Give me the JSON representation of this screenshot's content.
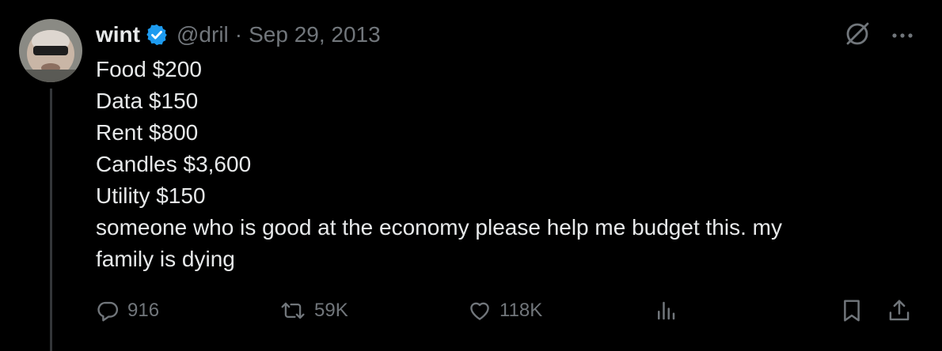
{
  "tweet": {
    "display_name": "wint",
    "handle": "@dril",
    "separator": "·",
    "date": "Sep 29, 2013",
    "lines": [
      "Food $200",
      "Data $150",
      "Rent $800",
      "Candles $3,600",
      "Utility $150",
      "someone who is good at the economy please help me budget this. my",
      "family is dying"
    ]
  },
  "actions": {
    "replies": "916",
    "retweets": "59K",
    "likes": "118K"
  },
  "icons": {
    "verified": "verified-badge-icon",
    "grok": "grok-icon",
    "more": "more-icon",
    "reply": "reply-icon",
    "retweet": "retweet-icon",
    "like": "heart-icon",
    "views": "views-icon",
    "bookmark": "bookmark-icon",
    "share": "share-icon"
  },
  "colors": {
    "background": "#000000",
    "text": "#e7e9ea",
    "secondary": "#71767b",
    "verified": "#1d9bf0",
    "thread_line": "#333639"
  }
}
